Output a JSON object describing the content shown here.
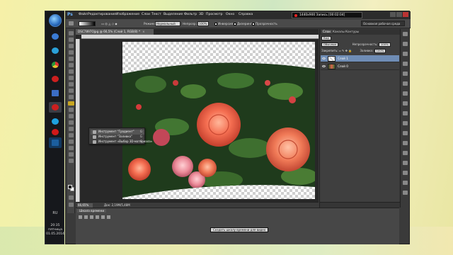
{
  "taskbar": {
    "apps": [
      {
        "name": "windows-start",
        "color": "#2a6cc0"
      },
      {
        "name": "recycle",
        "color": "#3a7bd5"
      },
      {
        "name": "media",
        "color": "#2aa0d8"
      },
      {
        "name": "chrome",
        "color": "#e8c130"
      },
      {
        "name": "opera",
        "color": "#cc1f1f"
      },
      {
        "name": "folder",
        "color": "#3b6dc4"
      },
      {
        "name": "opera-active",
        "color": "#cc1f1f"
      },
      {
        "name": "skype",
        "color": "#1ea1e0"
      },
      {
        "name": "recorder",
        "color": "#d01919"
      },
      {
        "name": "photoshop",
        "color": "#1b5e9e"
      }
    ],
    "language": "RU",
    "time": "20:35",
    "weekday": "пятница",
    "date": "01.05.2014"
  },
  "photoshop": {
    "logo": "Ps",
    "menu": [
      "Файл",
      "Редактирование",
      "Изображение",
      "Слои",
      "Текст",
      "Выделение",
      "Фильтр",
      "3D",
      "Просмотр",
      "Окно",
      "Справка"
    ],
    "record": "1440x900   Запись [00:02:04]",
    "options": {
      "mode_label": "Режим:",
      "mode_value": "Нормальный",
      "opacity_label": "Непрозр.:",
      "opacity_value": "100%",
      "inverse": "Инверсия",
      "dither": "Дизеринг",
      "transparency": "Прозрачность",
      "workspace": "Основная рабочая среда"
    },
    "document": {
      "tab": "DSC7897Ojpg @ 66,5% (Слой 1, RGB/8) *",
      "zoom": "66,65%",
      "info": "Док: 2,19M/5,48M"
    },
    "flyout": [
      {
        "label": "Инструмент \"Градиент\"",
        "key": "G"
      },
      {
        "label": "Инструмент \"Заливка\"",
        "key": "G"
      },
      {
        "label": "Инструмент «Выбор 3D-материала»",
        "key": "G"
      }
    ],
    "panels": {
      "tabs": [
        "Слои",
        "Каналы",
        "Контуры"
      ],
      "filter_label": "Вид",
      "blend_mode": "Обычные",
      "opacity_label": "Непрозрачность:",
      "opacity_value": "100%",
      "lock_label": "Закрепить:",
      "fill_label": "Заливка:",
      "fill_value": "100%",
      "layers": [
        {
          "name": "Слой 1",
          "selected": true
        },
        {
          "name": "Слой 0",
          "selected": false
        }
      ]
    },
    "timeline": {
      "title": "Шкала времени",
      "create_button": "Создать шкалу времени для видео"
    }
  }
}
